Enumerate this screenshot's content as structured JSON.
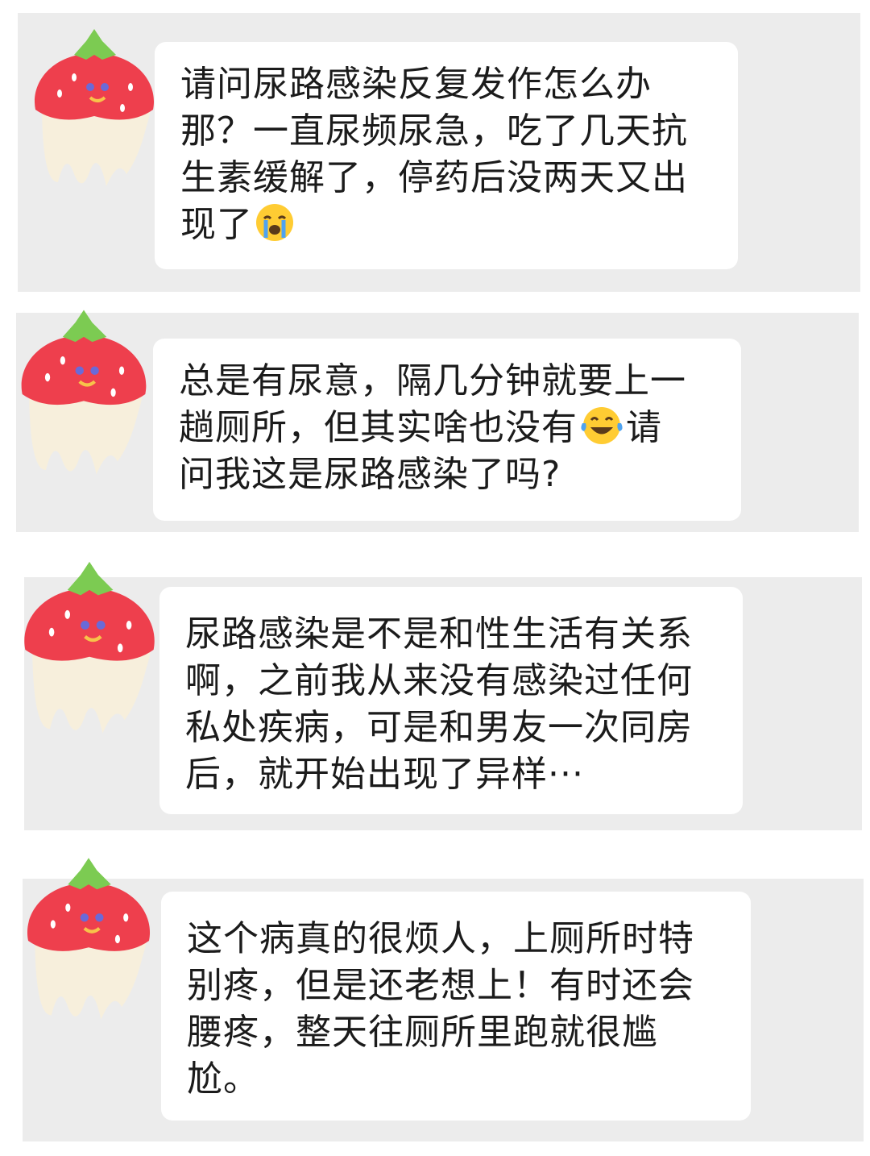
{
  "colors": {
    "card_background": "#ececec",
    "bubble_background": "#ffffff",
    "text": "#1b1b1b",
    "strawberry_red": "#ee3f4d",
    "leaf_green": "#7ccb52",
    "cream": "#f7efdc"
  },
  "messages": [
    {
      "avatar_icon": "strawberry-avatar-icon",
      "text_before_emoji": "请问尿路感染反复发作怎么办\n那？一直尿频尿急，吃了几天抗\n生素缓解了，停药后没两天又出\n现了",
      "emoji": "crying-face-emoji",
      "text_after_emoji": ""
    },
    {
      "avatar_icon": "strawberry-avatar-icon",
      "text_before_emoji": "总是有尿意，隔几分钟就要上一\n趟厕所，但其实啥也没有",
      "emoji": "tears-of-joy-emoji",
      "text_after_emoji": "请\n问我这是尿路感染了吗?"
    },
    {
      "avatar_icon": "strawberry-avatar-icon",
      "text": "尿路感染是不是和性生活有关系\n啊，之前我从来没有感染过任何\n私处疾病，可是和男友一次同房\n后，就开始出现了异样···"
    },
    {
      "avatar_icon": "strawberry-avatar-icon",
      "text": "这个病真的很烦人，上厕所时特\n别疼，但是还老想上！有时还会\n腰疼，整天往厕所里跑就很尴\n尬。"
    }
  ]
}
